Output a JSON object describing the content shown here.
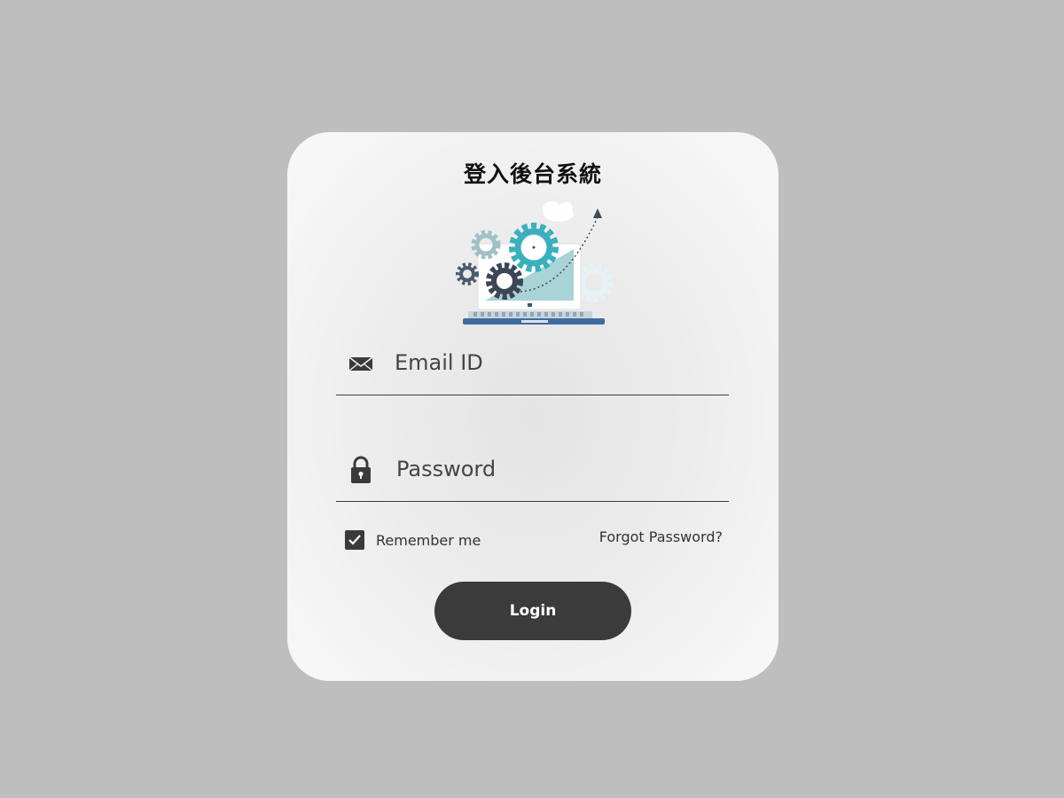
{
  "login_form": {
    "title": "登入後台系統",
    "email_placeholder": "Email ID",
    "password_placeholder": "Password",
    "remember_label": "Remember me",
    "remember_checked": true,
    "forgot_label": "Forgot Password?",
    "login_label": "Login"
  },
  "icons": {
    "email": "envelope-icon",
    "password": "lock-icon",
    "checkbox": "checkmark-icon",
    "illustration": "laptop-gears-illustration"
  },
  "colors": {
    "background": "#bebebe",
    "card": "#f4f4f4",
    "button": "#3b3b3b",
    "accent_teal": "#3bb0bd"
  }
}
